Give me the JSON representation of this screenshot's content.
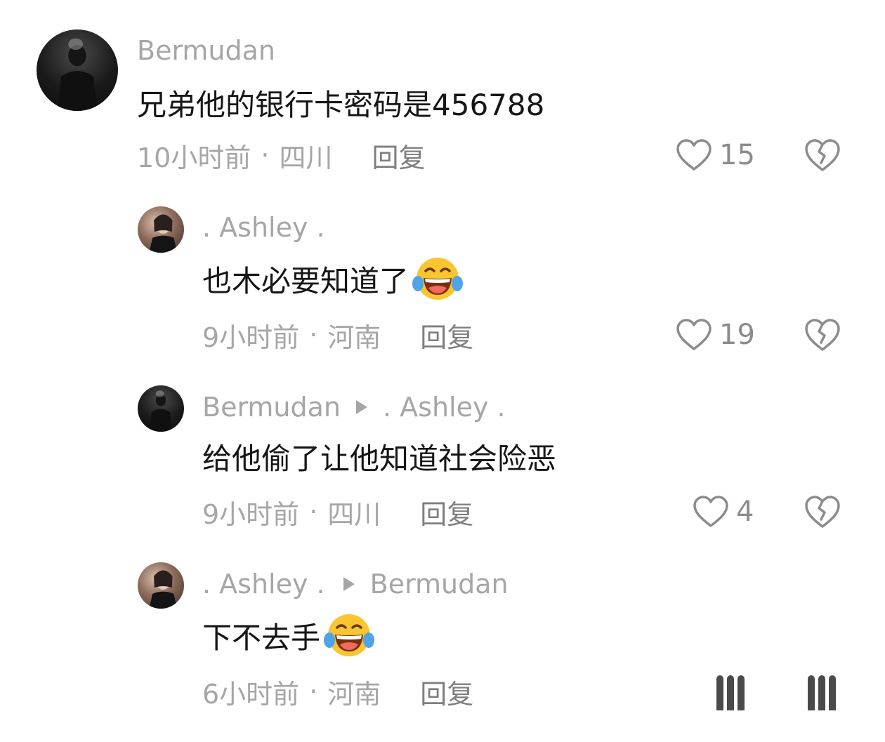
{
  "comments": [
    {
      "user": "Bermudan",
      "reply_to": "",
      "text": "兄弟他的银行卡密码是456788",
      "time": "10小时前",
      "location": "四川",
      "reply_label": "回复",
      "likes": "15"
    },
    {
      "user": ". Ashley .",
      "reply_to": "",
      "text": "也木必要知道了",
      "time": "9小时前",
      "location": "河南",
      "reply_label": "回复",
      "likes": "19",
      "emoji": "laughing-crying-emoji"
    },
    {
      "user": "Bermudan",
      "reply_to": ". Ashley .",
      "text": "给他偷了让他知道社会险恶",
      "time": "9小时前",
      "location": "四川",
      "reply_label": "回复",
      "likes": "4"
    },
    {
      "user": ". Ashley .",
      "reply_to": "Bermudan",
      "text": "下不去手",
      "time": "6小时前",
      "location": "河南",
      "reply_label": "回复",
      "emoji": "laughing-crying-emoji"
    }
  ],
  "separator": "·",
  "colors": {
    "username": "#a6a6a6",
    "text": "#161616",
    "meta": "#a6a6a6",
    "reply": "#7f7f7f",
    "icon": "#8c8c8c"
  }
}
